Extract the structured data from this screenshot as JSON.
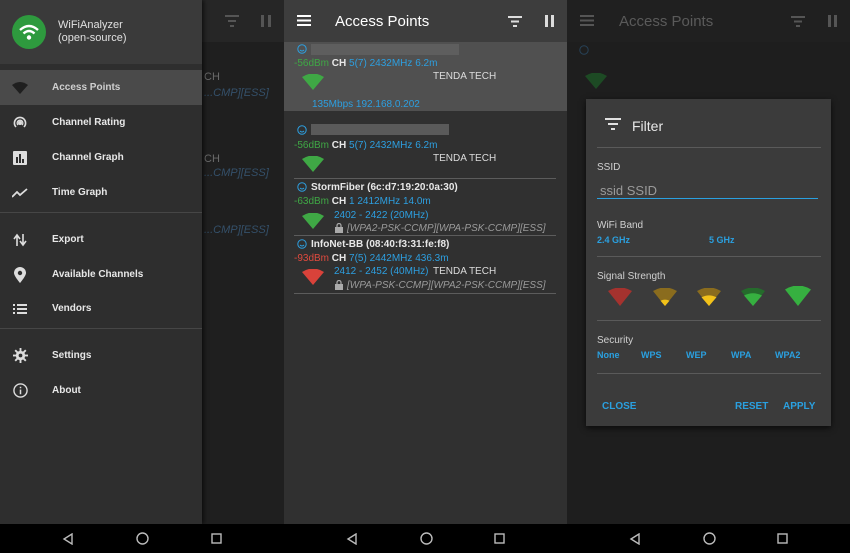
{
  "colors": {
    "accent": "#2aa0e0",
    "signal_good": "#3fa845",
    "signal_weak": "#e04a3e",
    "signal_medium": "#e0b030",
    "app_green": "#2e9a3e"
  },
  "drawer": {
    "app_name": "WiFiAnalyzer",
    "app_subtitle": "(open-source)",
    "items": [
      {
        "label": "Access Points",
        "icon": "wifi-icon"
      },
      {
        "label": "Channel Rating",
        "icon": "signal-rating-icon"
      },
      {
        "label": "Channel Graph",
        "icon": "bar-chart-icon"
      },
      {
        "label": "Time Graph",
        "icon": "line-chart-icon"
      },
      {
        "label": "Export",
        "icon": "export-arrows-icon"
      },
      {
        "label": "Available Channels",
        "icon": "location-pin-icon"
      },
      {
        "label": "Vendors",
        "icon": "list-icon"
      },
      {
        "label": "Settings",
        "icon": "gear-icon"
      },
      {
        "label": "About",
        "icon": "info-icon"
      }
    ],
    "background_fragments": [
      "CH",
      "...CMP][ESS]",
      "CH",
      "...CMP][ESS]",
      "...CMP][ESS]"
    ]
  },
  "access_points": {
    "title": "Access Points",
    "items": [
      {
        "level": "-56dBm",
        "ch_label": "CH",
        "channel": "5(7)",
        "freq": "2432MHz",
        "distance": "6.2m",
        "vendor": "TENDA TECH",
        "extra": "135Mbps 192.168.0.202"
      },
      {
        "level": "-56dBm",
        "ch_label": "CH",
        "channel": "5(7)",
        "freq": "2432MHz",
        "distance": "6.2m",
        "vendor": "TENDA TECH"
      },
      {
        "name": "StormFiber (6c:d7:19:20:0a:30)",
        "level": "-63dBm",
        "ch_label": "CH",
        "channel": "1",
        "freq": "2412MHz",
        "distance": "14.0m",
        "range": "2402 - 2422 (20MHz)",
        "security": "[WPA2-PSK-CCMP][WPA-PSK-CCMP][ESS]"
      },
      {
        "name": "InfoNet-BB (08:40:f3:31:fe:f8)",
        "level": "-93dBm",
        "ch_label": "CH",
        "channel": "7(5)",
        "freq": "2442MHz",
        "distance": "436.3m",
        "range": "2412 - 2452 (40MHz)",
        "vendor": "TENDA TECH",
        "security": "[WPA-PSK-CCMP][WPA2-PSK-CCMP][ESS]"
      }
    ]
  },
  "filter_dialog": {
    "toolbar_title": "Access Points",
    "title": "Filter",
    "ssid_label": "SSID",
    "ssid_value": "ssid SSID",
    "band_label": "WiFi Band",
    "bands": [
      "2.4 GHz",
      "5 GHz"
    ],
    "strength_label": "Signal Strength",
    "security_label": "Security",
    "security_options": [
      "None",
      "WPS",
      "WEP",
      "WPA",
      "WPA2"
    ],
    "close": "CLOSE",
    "reset": "RESET",
    "apply": "APPLY"
  }
}
